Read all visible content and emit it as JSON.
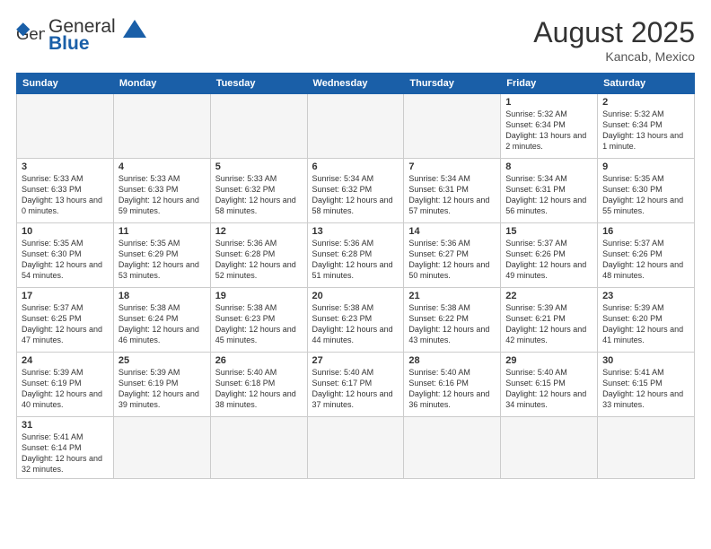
{
  "header": {
    "logo_general": "General",
    "logo_blue": "Blue",
    "month_year": "August 2025",
    "location": "Kancab, Mexico"
  },
  "days_of_week": [
    "Sunday",
    "Monday",
    "Tuesday",
    "Wednesday",
    "Thursday",
    "Friday",
    "Saturday"
  ],
  "weeks": [
    [
      {
        "day": "",
        "info": ""
      },
      {
        "day": "",
        "info": ""
      },
      {
        "day": "",
        "info": ""
      },
      {
        "day": "",
        "info": ""
      },
      {
        "day": "",
        "info": ""
      },
      {
        "day": "1",
        "info": "Sunrise: 5:32 AM\nSunset: 6:34 PM\nDaylight: 13 hours\nand 2 minutes."
      },
      {
        "day": "2",
        "info": "Sunrise: 5:32 AM\nSunset: 6:34 PM\nDaylight: 13 hours\nand 1 minute."
      }
    ],
    [
      {
        "day": "3",
        "info": "Sunrise: 5:33 AM\nSunset: 6:33 PM\nDaylight: 13 hours\nand 0 minutes."
      },
      {
        "day": "4",
        "info": "Sunrise: 5:33 AM\nSunset: 6:33 PM\nDaylight: 12 hours\nand 59 minutes."
      },
      {
        "day": "5",
        "info": "Sunrise: 5:33 AM\nSunset: 6:32 PM\nDaylight: 12 hours\nand 58 minutes."
      },
      {
        "day": "6",
        "info": "Sunrise: 5:34 AM\nSunset: 6:32 PM\nDaylight: 12 hours\nand 58 minutes."
      },
      {
        "day": "7",
        "info": "Sunrise: 5:34 AM\nSunset: 6:31 PM\nDaylight: 12 hours\nand 57 minutes."
      },
      {
        "day": "8",
        "info": "Sunrise: 5:34 AM\nSunset: 6:31 PM\nDaylight: 12 hours\nand 56 minutes."
      },
      {
        "day": "9",
        "info": "Sunrise: 5:35 AM\nSunset: 6:30 PM\nDaylight: 12 hours\nand 55 minutes."
      }
    ],
    [
      {
        "day": "10",
        "info": "Sunrise: 5:35 AM\nSunset: 6:30 PM\nDaylight: 12 hours\nand 54 minutes."
      },
      {
        "day": "11",
        "info": "Sunrise: 5:35 AM\nSunset: 6:29 PM\nDaylight: 12 hours\nand 53 minutes."
      },
      {
        "day": "12",
        "info": "Sunrise: 5:36 AM\nSunset: 6:28 PM\nDaylight: 12 hours\nand 52 minutes."
      },
      {
        "day": "13",
        "info": "Sunrise: 5:36 AM\nSunset: 6:28 PM\nDaylight: 12 hours\nand 51 minutes."
      },
      {
        "day": "14",
        "info": "Sunrise: 5:36 AM\nSunset: 6:27 PM\nDaylight: 12 hours\nand 50 minutes."
      },
      {
        "day": "15",
        "info": "Sunrise: 5:37 AM\nSunset: 6:26 PM\nDaylight: 12 hours\nand 49 minutes."
      },
      {
        "day": "16",
        "info": "Sunrise: 5:37 AM\nSunset: 6:26 PM\nDaylight: 12 hours\nand 48 minutes."
      }
    ],
    [
      {
        "day": "17",
        "info": "Sunrise: 5:37 AM\nSunset: 6:25 PM\nDaylight: 12 hours\nand 47 minutes."
      },
      {
        "day": "18",
        "info": "Sunrise: 5:38 AM\nSunset: 6:24 PM\nDaylight: 12 hours\nand 46 minutes."
      },
      {
        "day": "19",
        "info": "Sunrise: 5:38 AM\nSunset: 6:23 PM\nDaylight: 12 hours\nand 45 minutes."
      },
      {
        "day": "20",
        "info": "Sunrise: 5:38 AM\nSunset: 6:23 PM\nDaylight: 12 hours\nand 44 minutes."
      },
      {
        "day": "21",
        "info": "Sunrise: 5:38 AM\nSunset: 6:22 PM\nDaylight: 12 hours\nand 43 minutes."
      },
      {
        "day": "22",
        "info": "Sunrise: 5:39 AM\nSunset: 6:21 PM\nDaylight: 12 hours\nand 42 minutes."
      },
      {
        "day": "23",
        "info": "Sunrise: 5:39 AM\nSunset: 6:20 PM\nDaylight: 12 hours\nand 41 minutes."
      }
    ],
    [
      {
        "day": "24",
        "info": "Sunrise: 5:39 AM\nSunset: 6:19 PM\nDaylight: 12 hours\nand 40 minutes."
      },
      {
        "day": "25",
        "info": "Sunrise: 5:39 AM\nSunset: 6:19 PM\nDaylight: 12 hours\nand 39 minutes."
      },
      {
        "day": "26",
        "info": "Sunrise: 5:40 AM\nSunset: 6:18 PM\nDaylight: 12 hours\nand 38 minutes."
      },
      {
        "day": "27",
        "info": "Sunrise: 5:40 AM\nSunset: 6:17 PM\nDaylight: 12 hours\nand 37 minutes."
      },
      {
        "day": "28",
        "info": "Sunrise: 5:40 AM\nSunset: 6:16 PM\nDaylight: 12 hours\nand 36 minutes."
      },
      {
        "day": "29",
        "info": "Sunrise: 5:40 AM\nSunset: 6:15 PM\nDaylight: 12 hours\nand 34 minutes."
      },
      {
        "day": "30",
        "info": "Sunrise: 5:41 AM\nSunset: 6:15 PM\nDaylight: 12 hours\nand 33 minutes."
      }
    ],
    [
      {
        "day": "31",
        "info": "Sunrise: 5:41 AM\nSunset: 6:14 PM\nDaylight: 12 hours\nand 32 minutes."
      },
      {
        "day": "",
        "info": ""
      },
      {
        "day": "",
        "info": ""
      },
      {
        "day": "",
        "info": ""
      },
      {
        "day": "",
        "info": ""
      },
      {
        "day": "",
        "info": ""
      },
      {
        "day": "",
        "info": ""
      }
    ]
  ]
}
